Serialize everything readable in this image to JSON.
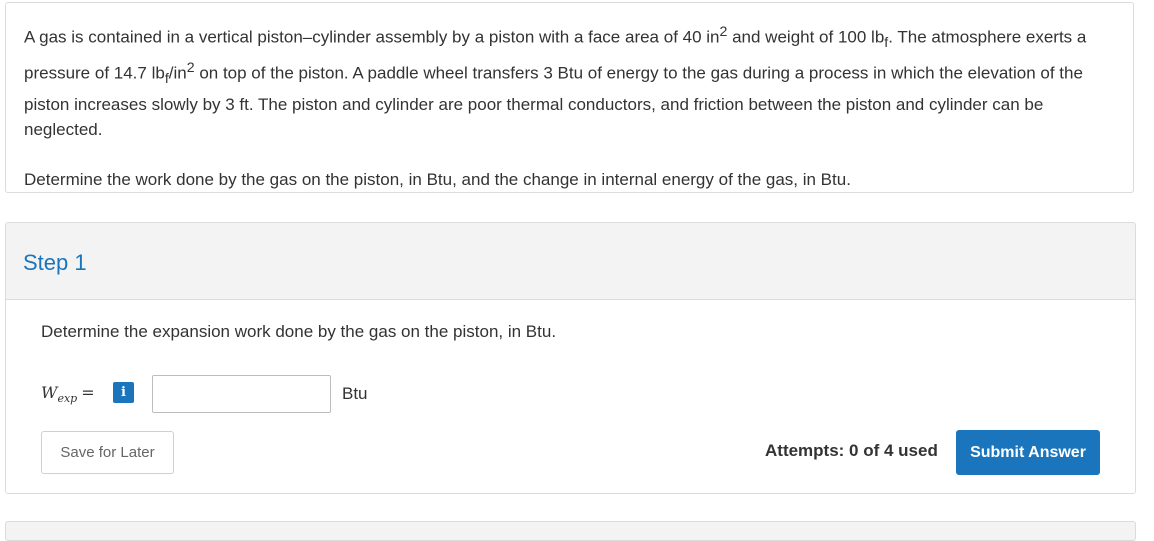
{
  "problem": {
    "text_part1": "A gas is contained in a vertical piston–cylinder assembly by a piston with a face area of 40 in",
    "text_part2": " and weight of 100 lb",
    "text_part3": ". The atmosphere exerts a pressure of 14.7 lb",
    "text_part4": "/in",
    "text_part5": " on top of the piston. A paddle wheel transfers 3 Btu of energy to the gas during a process in which the elevation of the piston increases slowly by 3 ft. The piston and cylinder are poor thermal conductors, and friction between the piston and cylinder can be neglected.",
    "sup_2": "2",
    "sub_f": "f",
    "question": "Determine the work done by the gas on the piston, in Btu, and the change in internal energy of the gas, in Btu."
  },
  "step": {
    "title": "Step 1",
    "question": "Determine the expansion work done by the gas on the piston, in Btu.",
    "variable": "W",
    "variable_sub": "exp",
    "equals": "=",
    "info_icon_glyph": "i",
    "input_value": "",
    "unit": "Btu"
  },
  "actions": {
    "save_label": "Save for Later",
    "attempts": "Attempts: 0 of 4 used",
    "submit_label": "Submit Answer"
  },
  "colors": {
    "accent": "#1a75bc",
    "header_bg": "#f3f3f3",
    "border": "#dcdcdc",
    "text": "#333333"
  }
}
